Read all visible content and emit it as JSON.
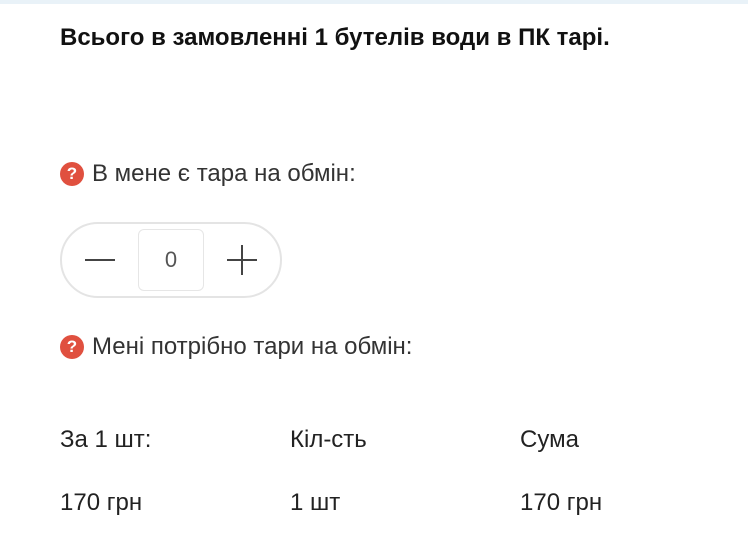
{
  "order_summary": "Всього в замовленні 1 бутелів води в ПК тарі.",
  "help_icon_glyph": "?",
  "accent_color": "#e0503f",
  "exchange_have": {
    "label": "В мене є тара на обмін:",
    "quantity": "0"
  },
  "exchange_need": {
    "label": "Мені потрібно тари на обмін:"
  },
  "table": {
    "headers": [
      "За 1 шт:",
      "Кіл-сть",
      "Сума"
    ],
    "values": [
      "170 грн",
      "1 шт",
      "170 грн"
    ]
  }
}
